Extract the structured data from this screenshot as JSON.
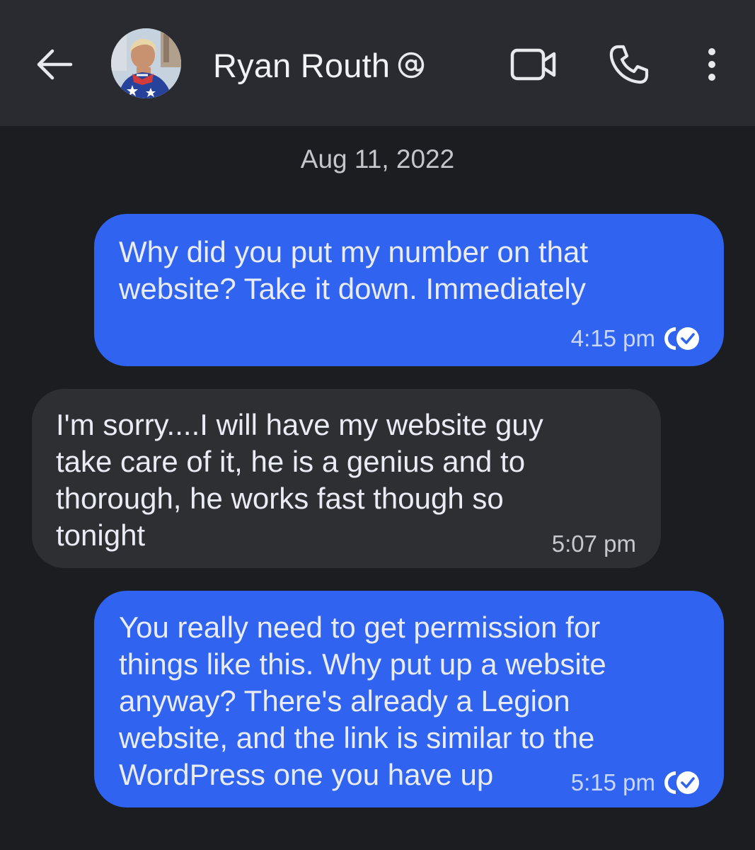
{
  "header": {
    "back_label": "Back",
    "contact_name": "Ryan Routh",
    "icons": {
      "back": "back-arrow-icon",
      "mention": "at-sign-icon",
      "video": "video-call-icon",
      "phone": "phone-icon",
      "menu": "more-vertical-icon"
    }
  },
  "conversation": {
    "date": "Aug 11, 2022",
    "messages": [
      {
        "direction": "outgoing",
        "text": "Why did you put my number on that\nwebsite? Take it down. Immediately",
        "time": "4:15 pm",
        "status": "read"
      },
      {
        "direction": "incoming",
        "text": "I'm sorry....I will have my website guy\ntake care of it, he is a genius and to\nthorough, he works fast though so\ntonight",
        "time": "5:07 pm"
      },
      {
        "direction": "outgoing",
        "text": "You really need to get permission for\nthings like this. Why put up a website\nanyway? There's already a Legion\nwebsite, and the link is similar to the\nWordPress one you have up",
        "time": "5:15 pm",
        "status": "read"
      }
    ]
  },
  "colors": {
    "background": "#1c1d21",
    "header": "#292b30",
    "outgoing_bubble": "#2f63f0",
    "incoming_bubble": "#2e2f33"
  }
}
